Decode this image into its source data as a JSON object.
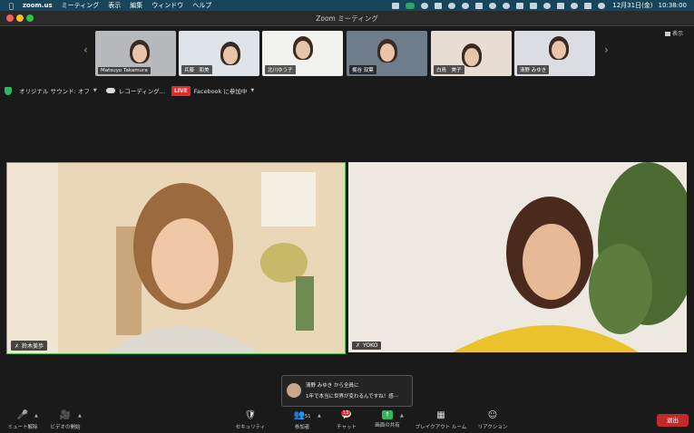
{
  "menubar": {
    "app": "zoom.us",
    "items": [
      "ミーティング",
      "表示",
      "編集",
      "ウィンドウ",
      "ヘルプ"
    ],
    "date": "12月31日(金)",
    "time": "10:38:00"
  },
  "window": {
    "title": "Zoom ミーティング"
  },
  "gallery": {
    "view_label": "表示",
    "participants": [
      {
        "name": "Matsuyo Takamura",
        "bg": "#b7b9bd"
      },
      {
        "name": "兵藤　和美",
        "bg": "#dfe4e8"
      },
      {
        "name": "北川ゆう子",
        "bg": "#f2f2f0"
      },
      {
        "name": "梶谷 双葉",
        "bg": "#6f7d8a"
      },
      {
        "name": "白鳥　美子",
        "bg": "#e8ddd3"
      },
      {
        "name": "清野 みゆき",
        "bg": "#dcdde2"
      }
    ]
  },
  "status": {
    "original_sound": "オリジナル サウンド: オフ",
    "recording": "レコーディング...",
    "live_badge": "LIVE",
    "facebook": "Facebook に参加中"
  },
  "main_videos": [
    {
      "name": "鈴木美歩",
      "active_speaker": true
    },
    {
      "name": "YOKO",
      "active_speaker": false
    }
  ],
  "chat_notification": {
    "from": "清野 みゆき から全員に",
    "message": "1年で本当に世界が変わるんですね！感···"
  },
  "toolbar": {
    "unmute": "ミュート解除",
    "start_video": "ビデオの開始",
    "security": "セキュリティ",
    "participants": "参加者",
    "participants_count": "51",
    "chat": "チャット",
    "chat_badge": "13",
    "share_screen": "画面の共有",
    "breakout_rooms": "ブレイクアウト ルーム",
    "reactions": "リアクション",
    "end": "退出"
  },
  "colors": {
    "accent_green": "#2fb85b",
    "live_red": "#e02b2b",
    "end_red": "#c22a2a",
    "menubar_bg": "#17465c"
  }
}
